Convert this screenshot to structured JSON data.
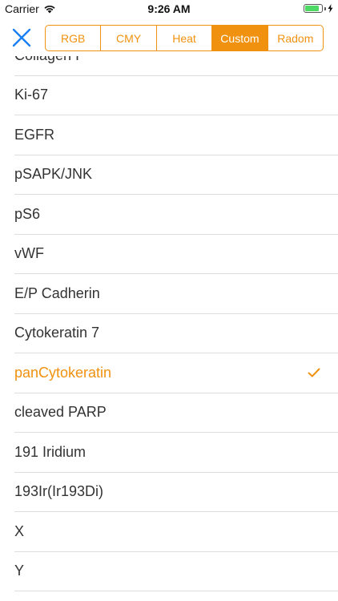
{
  "status_bar": {
    "carrier": "Carrier",
    "time": "9:26 AM",
    "battery_level": 0.85
  },
  "nav": {
    "close_icon": "close-icon",
    "segments": [
      "RGB",
      "CMY",
      "Heat",
      "Custom",
      "Radom"
    ],
    "selected_segment": "Custom"
  },
  "colors": {
    "accent": "#f0920f",
    "close_blue": "#1a7ff5",
    "battery_green": "#4cd964"
  },
  "list": {
    "items": [
      {
        "label": "Collagen I",
        "selected": false
      },
      {
        "label": "Ki-67",
        "selected": false
      },
      {
        "label": "EGFR",
        "selected": false
      },
      {
        "label": "pSAPK/JNK",
        "selected": false
      },
      {
        "label": "pS6",
        "selected": false
      },
      {
        "label": "vWF",
        "selected": false
      },
      {
        "label": "E/P Cadherin",
        "selected": false
      },
      {
        "label": "Cytokeratin 7",
        "selected": false
      },
      {
        "label": "panCytokeratin",
        "selected": true
      },
      {
        "label": "cleaved PARP",
        "selected": false
      },
      {
        "label": "191 Iridium",
        "selected": false
      },
      {
        "label": "193Ir(Ir193Di)",
        "selected": false
      },
      {
        "label": "X",
        "selected": false
      },
      {
        "label": "Y",
        "selected": false
      }
    ]
  }
}
